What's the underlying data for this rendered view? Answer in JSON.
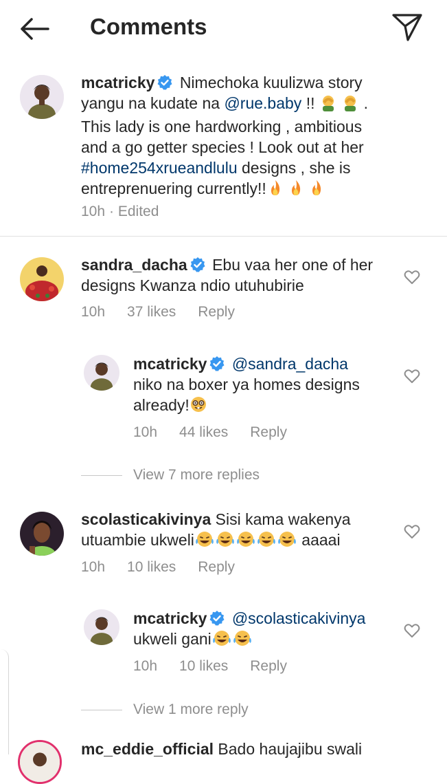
{
  "header": {
    "title": "Comments"
  },
  "caption": {
    "username": "mcatricky",
    "line1": "Nimechoka kuulizwa story",
    "line2_a": "yangu na kudate na ",
    "line2_mention": "@rue.baby",
    "line2_b": " !!",
    "line3": "This lady is one hardworking , ambitious",
    "line4": "and a go getter species ! Look out at her",
    "line5_tag": "#home254xrueandlulu",
    "line5_b": " designs , she is",
    "line6": "entreprenuering currently!!",
    "time": "10h",
    "edited": "· Edited"
  },
  "comments": [
    {
      "username": "sandra_dacha",
      "text_a": "Ebu vaa her one of her",
      "text_b": "designs Kwanza ndio utuhubirie",
      "time": "10h",
      "likes": "37 likes",
      "reply": "Reply"
    },
    {
      "username": "mcatricky",
      "mention": "@sandra_dacha",
      "text_a": "niko na boxer ya homes designs",
      "text_b": "already!",
      "time": "10h",
      "likes": "44 likes",
      "reply": "Reply"
    },
    {
      "username": "scolasticakivinya",
      "text_a": "Sisi kama wakenya",
      "text_b": "utuambie ukweli",
      "text_c": " aaaai",
      "time": "10h",
      "likes": "10 likes",
      "reply": "Reply"
    },
    {
      "username": "mcatricky",
      "mention": "@scolasticakivinya",
      "text_a": "ukweli gani",
      "time": "10h",
      "likes": "10 likes",
      "reply": "Reply"
    },
    {
      "username": "mc_eddie_official",
      "text_a": "Bado haujajibu swali"
    }
  ],
  "view_more": [
    "View 7 more replies",
    "View 1 more reply"
  ],
  "colors": {
    "link": "#00376b",
    "secondary": "#8e8e8e",
    "verified": "#3897f0"
  }
}
